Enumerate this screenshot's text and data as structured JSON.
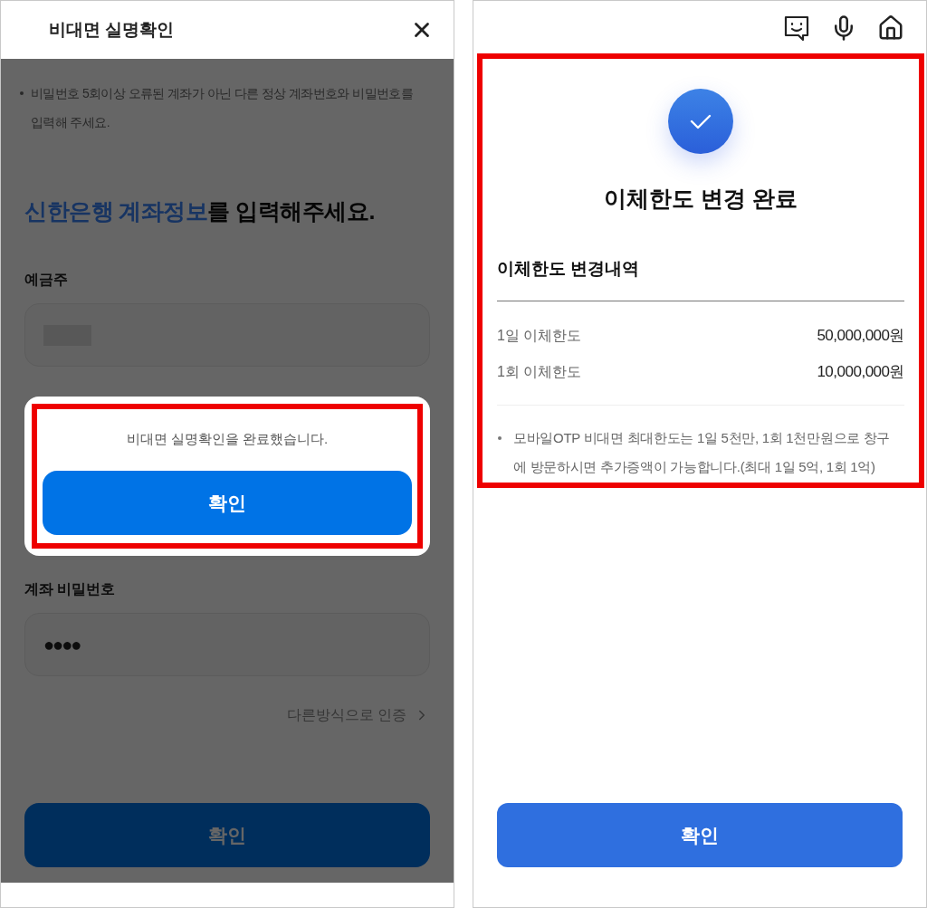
{
  "left_screen": {
    "title": "비대면 실명확인",
    "overlay": true,
    "notice": "비밀번호 5회이상 오류된 계좌가 아닌 다른 정상 계좌번호와 비밀번호를 입력해 주세요.",
    "heading": {
      "highlight": "신한은행 계좌정보",
      "rest": "를 입력해주세요."
    },
    "fields": [
      {
        "label": "예금주",
        "kind": "redacted"
      },
      {
        "label": "계좌 비밀번호",
        "kind": "password",
        "value": "●●●●"
      }
    ],
    "link": "다른방식으로 인증",
    "dialog": {
      "message": "비대면 실명확인을 완료했습니다.",
      "button": "확인",
      "highlighted": true
    },
    "submit_button": "확인"
  },
  "right_screen": {
    "result": {
      "highlighted": true,
      "title": "이체한도 변경 완료",
      "section_title": "이체한도 변경내역",
      "rows": [
        {
          "label": "1일 이체한도",
          "value": "50,000,000원"
        },
        {
          "label": "1회 이체한도",
          "value": "10,000,000원"
        }
      ],
      "note": "모바일OTP 비대면 최대한도는 1일 5천만, 1회 1천만원으로 창구에 방문하시면 추가증액이 가능합니다.(최대 1일 5억, 1회 1억)"
    },
    "button": "확인"
  }
}
